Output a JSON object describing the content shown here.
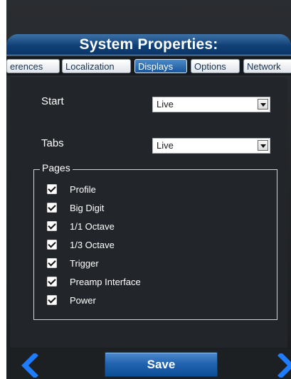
{
  "window": {
    "title": "System Properties:"
  },
  "tabs": [
    {
      "label": "erences",
      "active": false
    },
    {
      "label": "Localization",
      "active": false
    },
    {
      "label": "Displays",
      "active": true
    },
    {
      "label": "Options",
      "active": false
    },
    {
      "label": "Network",
      "active": false
    }
  ],
  "settings": {
    "start": {
      "label": "Start",
      "value": "Live"
    },
    "tabs": {
      "label": "Tabs",
      "value": "Live"
    }
  },
  "pages": {
    "label": "Pages",
    "items": [
      {
        "label": "Profile",
        "checked": true
      },
      {
        "label": "Big Digit",
        "checked": true
      },
      {
        "label": "1/1 Octave",
        "checked": true
      },
      {
        "label": "1/3 Octave",
        "checked": true
      },
      {
        "label": "Trigger",
        "checked": true
      },
      {
        "label": "Preamp Interface",
        "checked": true
      },
      {
        "label": "Power",
        "checked": true
      }
    ]
  },
  "footer": {
    "save_label": "Save",
    "left_icon": "chevron-left-icon",
    "right_icon": "chevron-right-icon"
  },
  "colors": {
    "accent": "#1a5698",
    "background": "#222529"
  }
}
